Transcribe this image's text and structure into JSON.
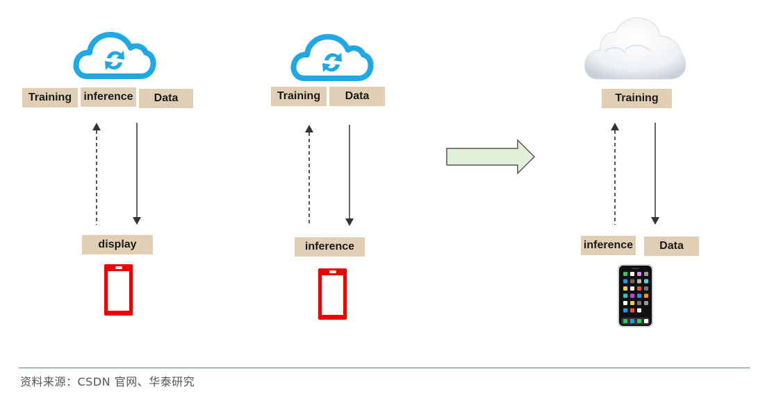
{
  "diagram": {
    "panels": [
      {
        "id": "panel-1",
        "cloud_icon": "cloud-sync-icon",
        "cloud_labels": [
          "Training",
          "inference",
          "Data"
        ],
        "device_labels": [
          "display"
        ],
        "device_icon": "red-phone-icon",
        "arrows": [
          {
            "direction": "up",
            "style": "dashed"
          },
          {
            "direction": "down",
            "style": "solid"
          }
        ]
      },
      {
        "id": "panel-2",
        "cloud_icon": "cloud-sync-icon",
        "cloud_labels": [
          "Training",
          "Data"
        ],
        "device_labels": [
          "inference"
        ],
        "device_icon": "red-phone-icon",
        "arrows": [
          {
            "direction": "up",
            "style": "dashed"
          },
          {
            "direction": "down",
            "style": "solid"
          }
        ]
      },
      {
        "id": "panel-3",
        "cloud_icon": "white-cloud-icon",
        "cloud_labels": [
          "Training"
        ],
        "device_labels": [
          "inference",
          "Data"
        ],
        "device_icon": "smartphone-apps-icon",
        "arrows": [
          {
            "direction": "up",
            "style": "dashed"
          },
          {
            "direction": "down",
            "style": "solid"
          }
        ]
      }
    ],
    "transition_arrow": "right-arrow-icon",
    "colors": {
      "label_bg": "#e0cfb4",
      "cloud_blue": "#1fa8e6",
      "phone_red": "#f00000",
      "arrow_green_fill": "#e2efd9",
      "arrow_gray": "#555555"
    }
  },
  "footer": {
    "source": "资料来源：CSDN 官网、华泰研究"
  }
}
